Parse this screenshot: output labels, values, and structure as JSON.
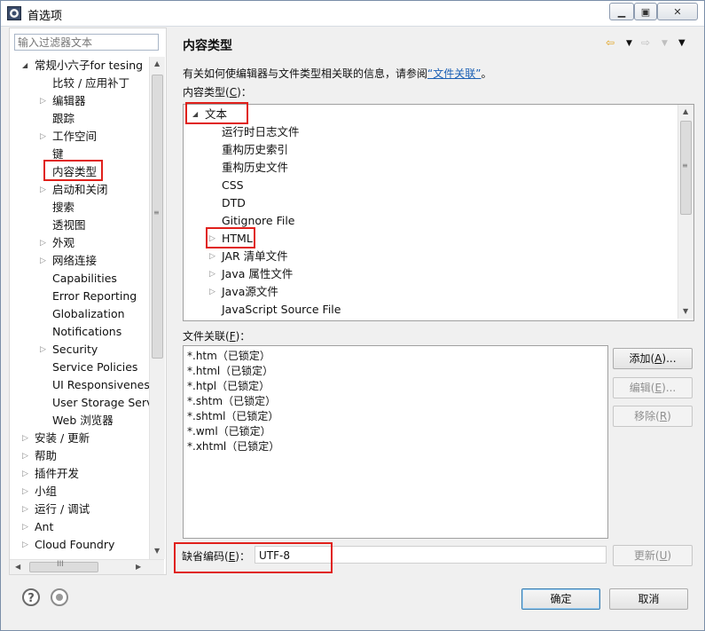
{
  "window": {
    "title": "首选项"
  },
  "left": {
    "filter_placeholder": "输入过滤器文本",
    "tree": [
      {
        "label": "常规小六子for tesing",
        "level": 0,
        "arrow": "expanded"
      },
      {
        "label": "比较 / 应用补丁",
        "level": 1,
        "arrow": ""
      },
      {
        "label": "编辑器",
        "level": 1,
        "arrow": "collapsed"
      },
      {
        "label": "跟踪",
        "level": 1,
        "arrow": ""
      },
      {
        "label": "工作空间",
        "level": 1,
        "arrow": "collapsed"
      },
      {
        "label": "键",
        "level": 1,
        "arrow": ""
      },
      {
        "label": "内容类型",
        "level": 1,
        "arrow": "",
        "selected": true
      },
      {
        "label": "启动和关闭",
        "level": 1,
        "arrow": "collapsed"
      },
      {
        "label": "搜索",
        "level": 1,
        "arrow": ""
      },
      {
        "label": "透视图",
        "level": 1,
        "arrow": ""
      },
      {
        "label": "外观",
        "level": 1,
        "arrow": "collapsed"
      },
      {
        "label": "网络连接",
        "level": 1,
        "arrow": "collapsed"
      },
      {
        "label": "Capabilities",
        "level": 1,
        "arrow": ""
      },
      {
        "label": "Error Reporting",
        "level": 1,
        "arrow": ""
      },
      {
        "label": "Globalization",
        "level": 1,
        "arrow": ""
      },
      {
        "label": "Notifications",
        "level": 1,
        "arrow": ""
      },
      {
        "label": "Security",
        "level": 1,
        "arrow": "collapsed"
      },
      {
        "label": "Service Policies",
        "level": 1,
        "arrow": ""
      },
      {
        "label": "UI Responsiveness",
        "level": 1,
        "arrow": ""
      },
      {
        "label": "User Storage Serv",
        "level": 1,
        "arrow": ""
      },
      {
        "label": "Web 浏览器",
        "level": 1,
        "arrow": ""
      },
      {
        "label": "安装 / 更新",
        "level": 0,
        "arrow": "collapsed"
      },
      {
        "label": "帮助",
        "level": 0,
        "arrow": "collapsed"
      },
      {
        "label": "插件开发",
        "level": 0,
        "arrow": "collapsed"
      },
      {
        "label": "小组",
        "level": 0,
        "arrow": "collapsed"
      },
      {
        "label": "运行 / 调试",
        "level": 0,
        "arrow": "collapsed"
      },
      {
        "label": "Ant",
        "level": 0,
        "arrow": "collapsed"
      },
      {
        "label": "Cloud Foundry",
        "level": 0,
        "arrow": "collapsed"
      }
    ],
    "hscroll_grip": "III"
  },
  "page": {
    "title": "内容类型",
    "description_prefix": "有关如何使编辑器与文件类型相关联的信息，请参阅",
    "description_link": "“文件关联”",
    "description_suffix": "。",
    "content_types_label": "内容类型(",
    "content_types_key": "C",
    "content_types_suffix": ")：",
    "content_types": [
      {
        "label": "文本",
        "level": 0,
        "arrow": "expanded"
      },
      {
        "label": "运行时日志文件",
        "level": 1,
        "arrow": ""
      },
      {
        "label": "重构历史索引",
        "level": 1,
        "arrow": ""
      },
      {
        "label": "重构历史文件",
        "level": 1,
        "arrow": ""
      },
      {
        "label": "CSS",
        "level": 1,
        "arrow": ""
      },
      {
        "label": "DTD",
        "level": 1,
        "arrow": ""
      },
      {
        "label": "Gitignore File",
        "level": 1,
        "arrow": ""
      },
      {
        "label": "HTML",
        "level": 1,
        "arrow": "collapsed"
      },
      {
        "label": "JAR 清单文件",
        "level": 1,
        "arrow": "collapsed"
      },
      {
        "label": "Java 属性文件",
        "level": 1,
        "arrow": "collapsed"
      },
      {
        "label": "Java源文件",
        "level": 1,
        "arrow": "collapsed"
      },
      {
        "label": "JavaScript Source File",
        "level": 1,
        "arrow": ""
      }
    ],
    "file_assoc_label": "文件关联(",
    "file_assoc_key": "F",
    "file_assoc_suffix": ")：",
    "file_associations": [
      "*.htm（已锁定）",
      "*.html（已锁定）",
      "*.htpl（已锁定）",
      "*.shtm（已锁定）",
      "*.shtml（已锁定）",
      "*.wml（已锁定）",
      "*.xhtml（已锁定）"
    ],
    "buttons": {
      "add_pre": "添加(",
      "add_key": "A",
      "add_post": ")...",
      "edit_pre": "编辑(",
      "edit_key": "E",
      "edit_post": ")...",
      "remove_pre": "移除(",
      "remove_key": "R",
      "remove_post": ")",
      "update_pre": "更新(",
      "update_key": "U",
      "update_post": ")"
    },
    "encoding_label_pre": "缺省编码(",
    "encoding_label_key": "E",
    "encoding_label_post": ")：",
    "encoding_value": "UTF-8"
  },
  "footer": {
    "ok_label": "确定",
    "cancel_label": "取消"
  },
  "colors": {
    "highlight": "#e0201b",
    "link": "#1a5fb4"
  }
}
